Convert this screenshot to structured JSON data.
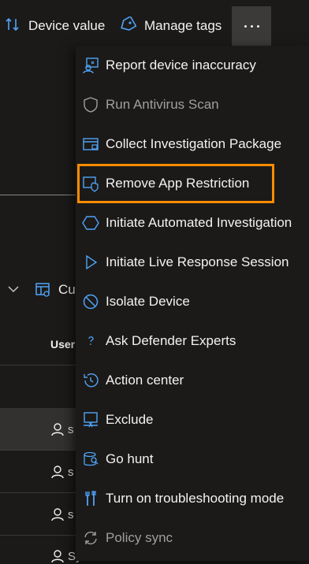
{
  "toolbar": {
    "device_value_label": "Device value",
    "manage_tags_label": "Manage tags",
    "more_label": "More actions"
  },
  "background": {
    "cust_label": "Cu",
    "user_column_header": "User",
    "rows": [
      {
        "user": "s"
      },
      {
        "user": "s"
      },
      {
        "user": "s"
      },
      {
        "user": "System"
      }
    ]
  },
  "menu": {
    "items": [
      {
        "label": "Report device inaccuracy",
        "icon": "report-icon",
        "enabled": true
      },
      {
        "label": "Run Antivirus Scan",
        "icon": "shield-icon",
        "enabled": false
      },
      {
        "label": "Collect Investigation Package",
        "icon": "package-icon",
        "enabled": true
      },
      {
        "label": "Remove App Restriction",
        "icon": "app-restriction-icon",
        "enabled": true,
        "highlighted": true
      },
      {
        "label": "Initiate Automated Investigation",
        "icon": "hexagon-icon",
        "enabled": true
      },
      {
        "label": "Initiate Live Response Session",
        "icon": "play-icon",
        "enabled": true
      },
      {
        "label": "Isolate Device",
        "icon": "block-icon",
        "enabled": true
      },
      {
        "label": "Ask Defender Experts",
        "icon": "question-icon",
        "enabled": true
      },
      {
        "label": "Action center",
        "icon": "history-icon",
        "enabled": true
      },
      {
        "label": "Exclude",
        "icon": "exclude-icon",
        "enabled": true
      },
      {
        "label": "Go hunt",
        "icon": "hunt-icon",
        "enabled": true
      },
      {
        "label": "Turn on troubleshooting mode",
        "icon": "troubleshoot-icon",
        "enabled": true
      },
      {
        "label": "Policy sync",
        "icon": "sync-icon",
        "enabled": false
      }
    ]
  },
  "colors": {
    "accent": "#4fa3f7",
    "highlight_outline": "#ff8c00",
    "background": "#1b1a19",
    "more_button_bg": "#3b3a39"
  }
}
